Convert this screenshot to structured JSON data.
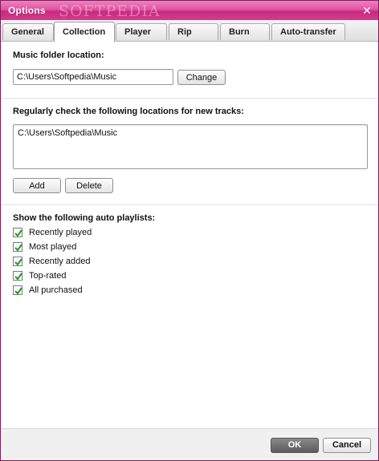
{
  "window": {
    "title": "Options",
    "watermark": "SOFTPEDIA"
  },
  "tabs": [
    {
      "label": "General"
    },
    {
      "label": "Collection"
    },
    {
      "label": "Player"
    },
    {
      "label": "Rip"
    },
    {
      "label": "Burn"
    },
    {
      "label": "Auto-transfer"
    }
  ],
  "active_tab": "Collection",
  "music_folder": {
    "label": "Music folder location:",
    "value": "C:\\Users\\Softpedia\\Music",
    "change_label": "Change"
  },
  "locations": {
    "label": "Regularly check the following locations for new tracks:",
    "items": [
      "C:\\Users\\Softpedia\\Music"
    ],
    "add_label": "Add",
    "delete_label": "Delete"
  },
  "auto_playlists": {
    "label": "Show the following auto playlists:",
    "items": [
      {
        "label": "Recently played",
        "checked": true
      },
      {
        "label": "Most played",
        "checked": true
      },
      {
        "label": "Recently added",
        "checked": true
      },
      {
        "label": "Top-rated",
        "checked": true
      },
      {
        "label": "All purchased",
        "checked": true
      }
    ]
  },
  "footer": {
    "ok_label": "OK",
    "cancel_label": "Cancel"
  },
  "colors": {
    "title_accent": "#d23b8c",
    "check": "#1f9a1f"
  }
}
